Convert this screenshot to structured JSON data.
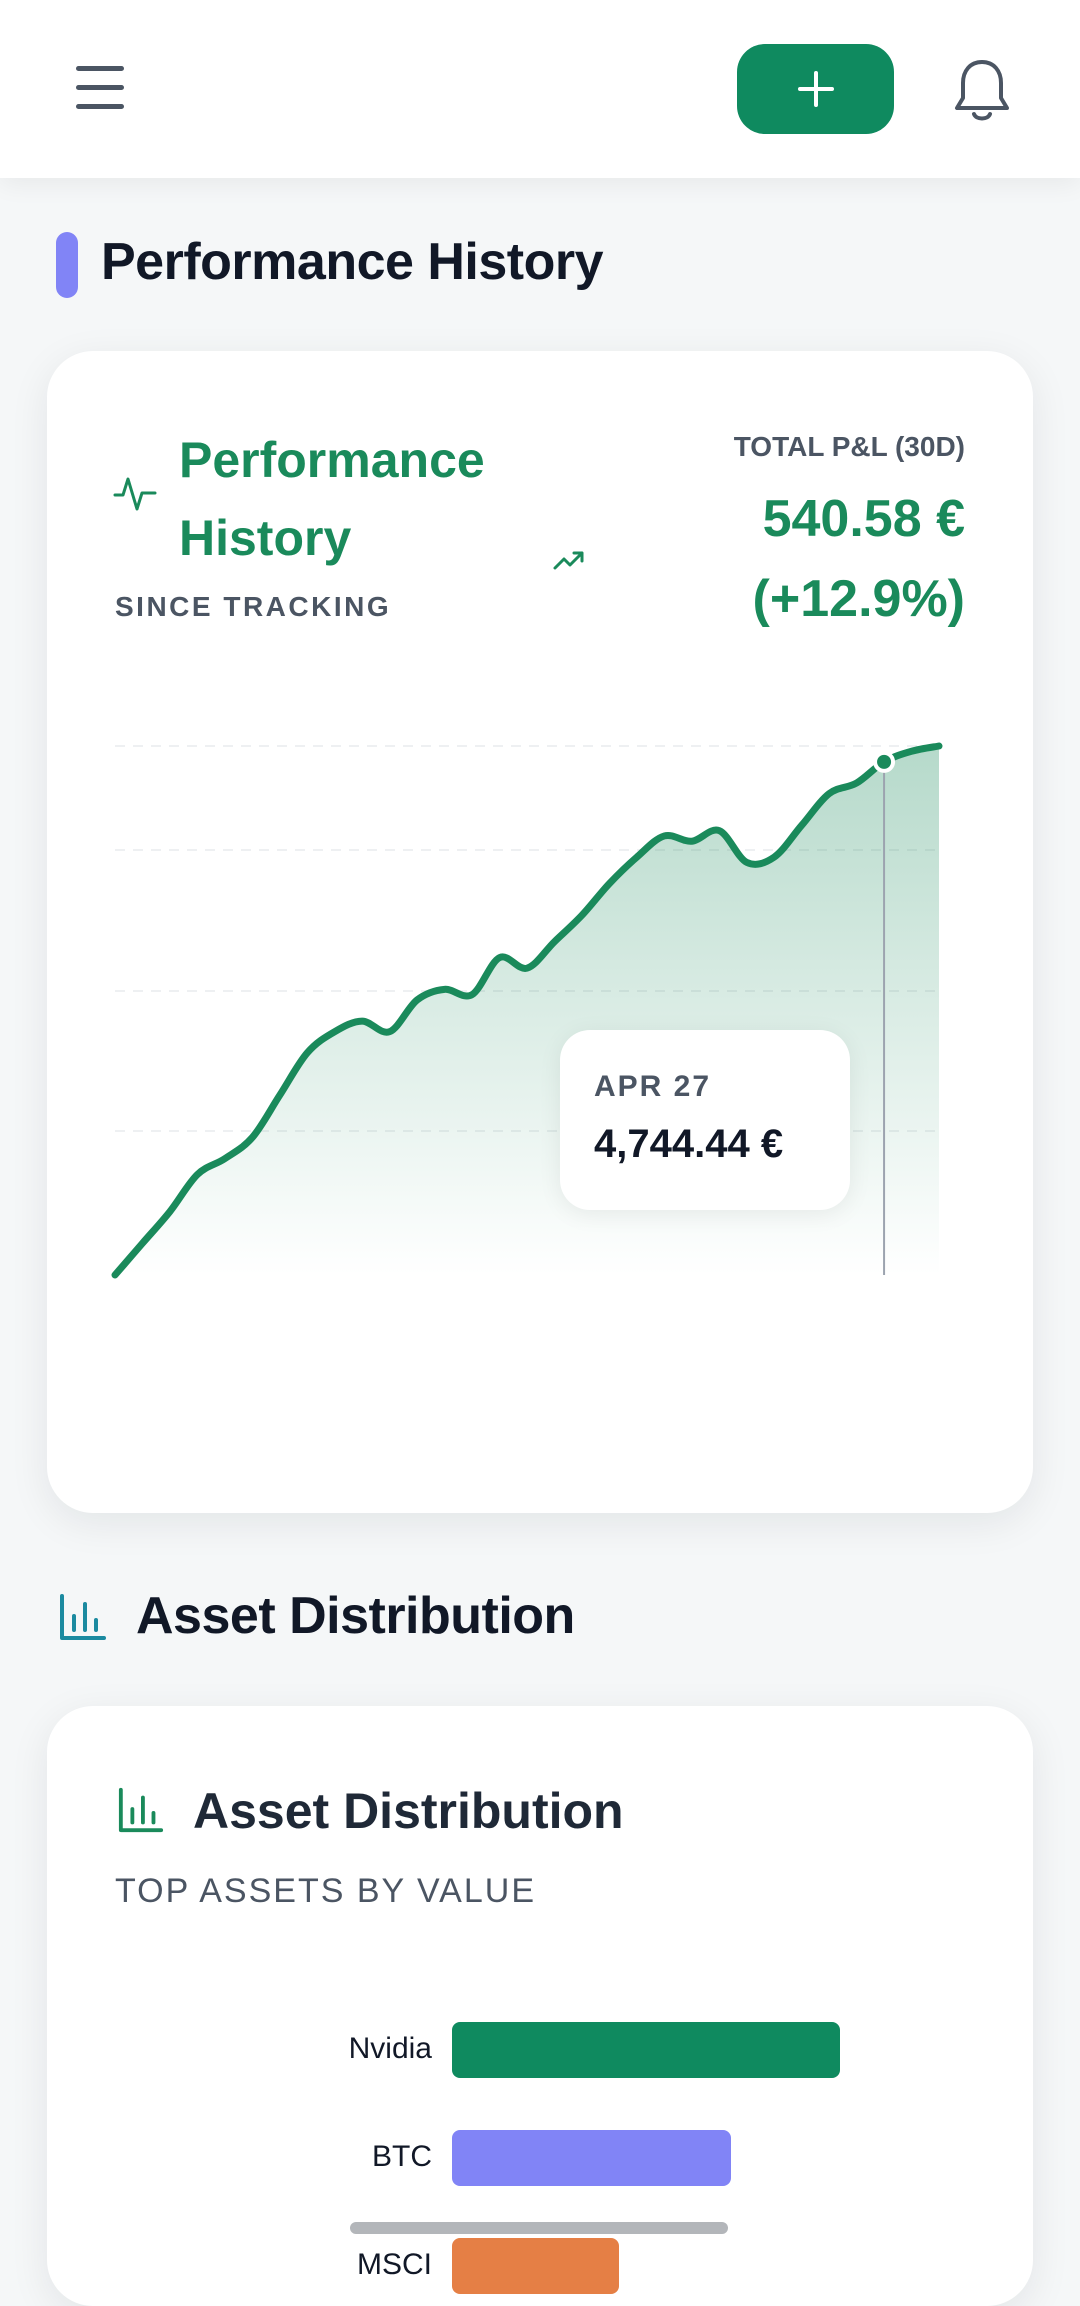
{
  "header": {
    "menu_icon": "hamburger-icon",
    "add_icon": "plus-icon",
    "notifications_icon": "bell-icon"
  },
  "performance": {
    "section_title": "Performance History",
    "card_title": "Performance History",
    "subtitle": "SINCE TRACKING",
    "pl_label": "TOTAL P&L (30D)",
    "pl_value": "540.58 €",
    "pl_percent": "(+12.9%)",
    "tooltip": {
      "date": "APR 27",
      "value": "4,744.44 €"
    }
  },
  "distribution": {
    "section_title": "Asset Distribution",
    "card_title": "Asset Distribution",
    "subtitle": "TOP ASSETS BY VALUE"
  },
  "colors": {
    "accent_green": "#0f8a5f",
    "line_green": "#1a8a5b",
    "section_purple": "#8184f6",
    "btc_purple": "#8184f6",
    "msci_orange": "#e57f45",
    "distribution_icon": "#1b8aa0"
  },
  "chart_data": [
    {
      "type": "area",
      "title": "",
      "xlabel": "",
      "ylabel": "",
      "grid": true,
      "series": [
        {
          "values": [
            0.0,
            0.06,
            0.12,
            0.19,
            0.22,
            0.26,
            0.34,
            0.42,
            0.46,
            0.48,
            0.46,
            0.52,
            0.54,
            0.53,
            0.6,
            0.58,
            0.63,
            0.68,
            0.74,
            0.79,
            0.83,
            0.82,
            0.84,
            0.78,
            0.79,
            0.85,
            0.91,
            0.93,
            0.97,
            0.99,
            1.0
          ]
        }
      ],
      "highlight": {
        "date": "APR 27",
        "value": "4,744.44 €"
      }
    },
    {
      "type": "bar",
      "orientation": "horizontal",
      "categories": [
        "Nvidia",
        "BTC",
        "MSCI"
      ],
      "values": [
        100,
        72,
        43
      ],
      "xlim": [
        0,
        100
      ]
    }
  ]
}
